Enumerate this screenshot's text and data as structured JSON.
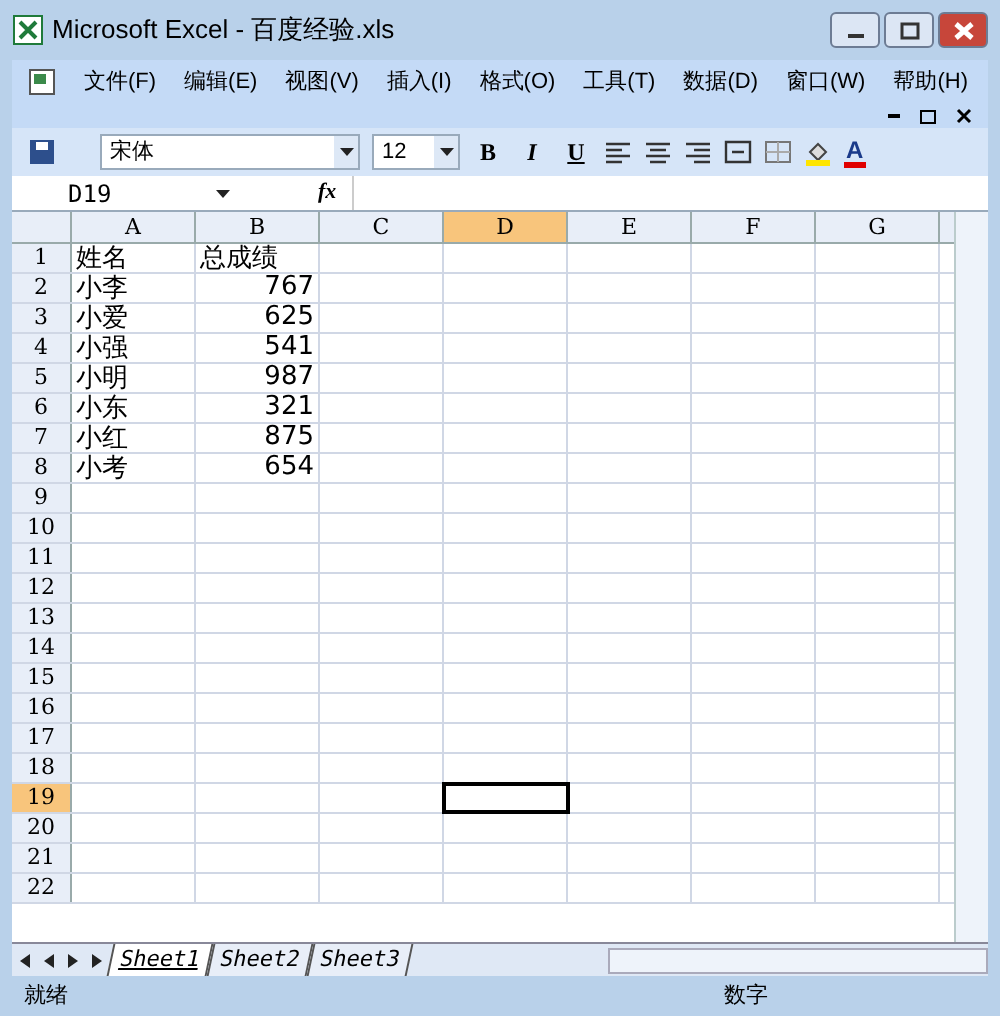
{
  "window": {
    "title": "Microsoft Excel - 百度经验.xls"
  },
  "menu": [
    "文件(F)",
    "编辑(E)",
    "视图(V)",
    "插入(I)",
    "格式(O)",
    "工具(T)",
    "数据(D)",
    "窗口(W)",
    "帮助(H)"
  ],
  "toolbar": {
    "font": "宋体",
    "size": "12",
    "bold": "B",
    "italic": "I",
    "underline": "U",
    "font_color": "A"
  },
  "formula_bar": {
    "name_box": "D19",
    "fx": "fx"
  },
  "columns": [
    {
      "label": "A",
      "selected": false
    },
    {
      "label": "B",
      "selected": false
    },
    {
      "label": "C",
      "selected": false
    },
    {
      "label": "D",
      "selected": true
    },
    {
      "label": "E",
      "selected": false
    },
    {
      "label": "F",
      "selected": false
    },
    {
      "label": "G",
      "selected": false
    }
  ],
  "rows": [
    {
      "label": "1",
      "selected": false,
      "cells": [
        {
          "text": "姓名",
          "kind": "text"
        },
        {
          "text": "总成绩",
          "kind": "text"
        }
      ]
    },
    {
      "label": "2",
      "selected": false,
      "cells": [
        {
          "text": "小李",
          "kind": "text"
        },
        {
          "text": "767",
          "kind": "number"
        }
      ]
    },
    {
      "label": "3",
      "selected": false,
      "cells": [
        {
          "text": "小爱",
          "kind": "text"
        },
        {
          "text": "625",
          "kind": "number"
        }
      ]
    },
    {
      "label": "4",
      "selected": false,
      "cells": [
        {
          "text": "小强",
          "kind": "text"
        },
        {
          "text": "541",
          "kind": "number"
        }
      ]
    },
    {
      "label": "5",
      "selected": false,
      "cells": [
        {
          "text": "小明",
          "kind": "text"
        },
        {
          "text": "987",
          "kind": "number"
        }
      ]
    },
    {
      "label": "6",
      "selected": false,
      "cells": [
        {
          "text": "小东",
          "kind": "text"
        },
        {
          "text": "321",
          "kind": "number"
        }
      ]
    },
    {
      "label": "7",
      "selected": false,
      "cells": [
        {
          "text": "小红",
          "kind": "text"
        },
        {
          "text": "875",
          "kind": "number"
        }
      ]
    },
    {
      "label": "8",
      "selected": false,
      "cells": [
        {
          "text": "小考",
          "kind": "text"
        },
        {
          "text": "654",
          "kind": "number"
        }
      ]
    },
    {
      "label": "9",
      "selected": false
    },
    {
      "label": "10",
      "selected": false
    },
    {
      "label": "11",
      "selected": false
    },
    {
      "label": "12",
      "selected": false
    },
    {
      "label": "13",
      "selected": false
    },
    {
      "label": "14",
      "selected": false
    },
    {
      "label": "15",
      "selected": false
    },
    {
      "label": "16",
      "selected": false
    },
    {
      "label": "17",
      "selected": false
    },
    {
      "label": "18",
      "selected": false
    },
    {
      "label": "19",
      "selected": true
    },
    {
      "label": "20",
      "selected": false
    },
    {
      "label": "21",
      "selected": false
    },
    {
      "label": "22",
      "selected": false
    }
  ],
  "sheet_tabs": [
    {
      "label": "Sheet1",
      "selected": true
    },
    {
      "label": "Sheet2",
      "selected": false
    },
    {
      "label": "Sheet3",
      "selected": false
    }
  ],
  "status_bar": {
    "state": "就绪",
    "mode": "数字"
  }
}
